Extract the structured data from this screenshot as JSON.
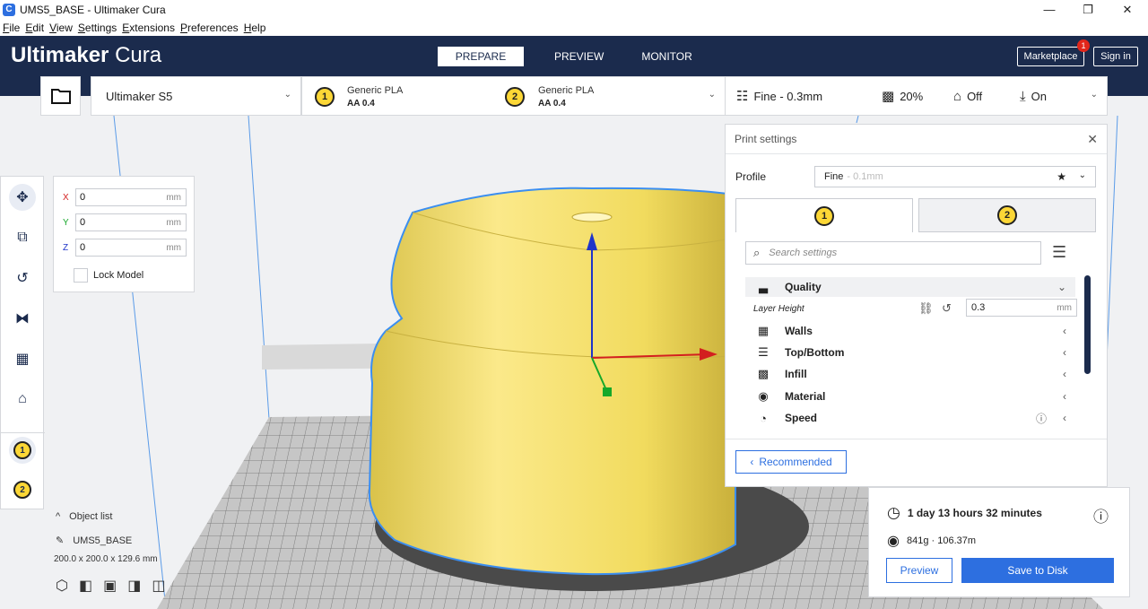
{
  "window": {
    "title": "UMS5_BASE - Ultimaker Cura",
    "app_icon": "C",
    "minimize": "—",
    "maximize": "❐",
    "close": "✕"
  },
  "menu": [
    {
      "pre": "",
      "u": "F",
      "post": "ile"
    },
    {
      "pre": "",
      "u": "E",
      "post": "dit"
    },
    {
      "pre": "",
      "u": "V",
      "post": "iew"
    },
    {
      "pre": "",
      "u": "S",
      "post": "ettings"
    },
    {
      "pre": "",
      "u": "E",
      "post": "xtensions"
    },
    {
      "pre": "",
      "u": "P",
      "post": "references"
    },
    {
      "pre": "",
      "u": "H",
      "post": "elp"
    }
  ],
  "header": {
    "brand_bold": "Ultimaker",
    "brand_light": "Cura",
    "tabs": [
      "PREPARE",
      "PREVIEW",
      "MONITOR"
    ],
    "marketplace": "Marketplace",
    "marketplace_badge": "1",
    "sign_in": "Sign in"
  },
  "printer": {
    "name": "Ultimaker S5"
  },
  "extruders": [
    {
      "index": "1",
      "material": "Generic PLA",
      "core": "AA 0.4"
    },
    {
      "index": "2",
      "material": "Generic PLA",
      "core": "AA 0.4"
    }
  ],
  "print_summary": {
    "profile": "Fine - 0.3mm",
    "infill": "20%",
    "support": "Off",
    "adhesion": "On"
  },
  "move_tool": {
    "x": {
      "label": "X",
      "value": "0",
      "unit": "mm"
    },
    "y": {
      "label": "Y",
      "value": "0",
      "unit": "mm"
    },
    "z": {
      "label": "Z",
      "value": "0",
      "unit": "mm"
    },
    "lock_label": "Lock Model"
  },
  "print_settings": {
    "title": "Print settings",
    "profile_label": "Profile",
    "profile_value": "Fine",
    "profile_sub": "- 0.1mm",
    "search_placeholder": "Search settings",
    "categories": [
      {
        "label": "Quality",
        "icon": "quality-icon",
        "glyph": "▃",
        "chevron": "⌄"
      },
      {
        "label": "Walls",
        "icon": "walls-icon",
        "glyph": "▦",
        "chevron": "‹"
      },
      {
        "label": "Top/Bottom",
        "icon": "top-bottom-icon",
        "glyph": "☰",
        "chevron": "‹"
      },
      {
        "label": "Infill",
        "icon": "infill-icon",
        "glyph": "▩",
        "chevron": "‹"
      },
      {
        "label": "Material",
        "icon": "material-icon",
        "glyph": "◉",
        "chevron": "‹"
      },
      {
        "label": "Speed",
        "icon": "speed-icon",
        "glyph": "◔",
        "chevron": "‹"
      }
    ],
    "layer_height": {
      "label": "Layer Height",
      "value": "0.3",
      "unit": "mm"
    },
    "recommended": "Recommended"
  },
  "output": {
    "time": "1 day 13 hours 32 minutes",
    "material": "841g · 106.37m",
    "preview_btn": "Preview",
    "save_btn": "Save to Disk"
  },
  "object_list": {
    "header": "Object list",
    "object_name": "UMS5_BASE",
    "dimensions": "200.0 x 200.0 x 129.6 mm"
  },
  "colors": {
    "header_bg": "#1b2b4d",
    "accent": "#2d6fe0",
    "model": "#f5e16d",
    "model_outline": "#3b8ef0",
    "badge": "#e2261b"
  }
}
